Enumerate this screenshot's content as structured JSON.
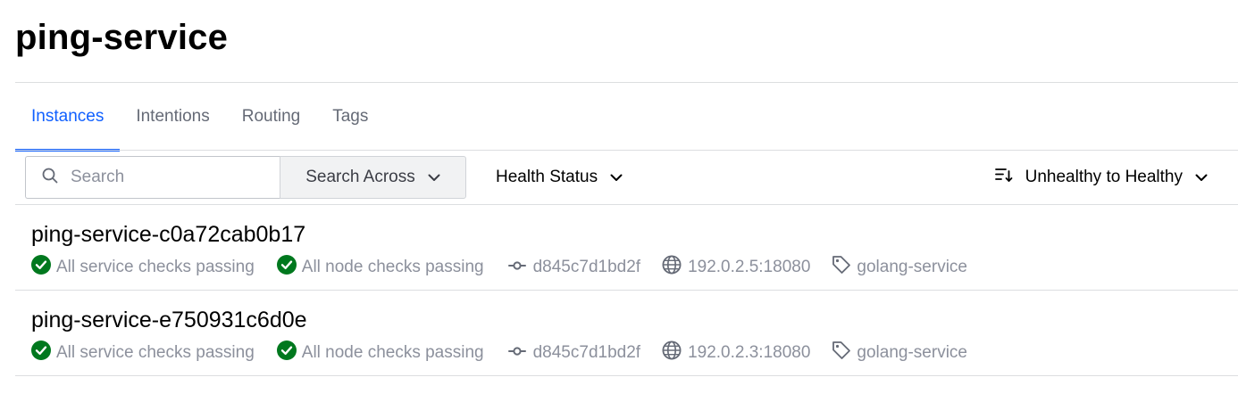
{
  "page": {
    "title": "ping-service"
  },
  "tabs": [
    {
      "label": "Instances",
      "active": true
    },
    {
      "label": "Intentions",
      "active": false
    },
    {
      "label": "Routing",
      "active": false
    },
    {
      "label": "Tags",
      "active": false
    }
  ],
  "toolbar": {
    "search_placeholder": "Search",
    "search_across_label": "Search Across",
    "health_status_label": "Health Status",
    "sort_label": "Unhealthy to Healthy"
  },
  "instances": [
    {
      "name": "ping-service-c0a72cab0b17",
      "service_checks": "All service checks passing",
      "node_checks": "All node checks passing",
      "node": "d845c7d1bd2f",
      "address": "192.0.2.5:18080",
      "tag": "golang-service"
    },
    {
      "name": "ping-service-e750931c6d0e",
      "service_checks": "All service checks passing",
      "node_checks": "All node checks passing",
      "node": "d845c7d1bd2f",
      "address": "192.0.2.3:18080",
      "tag": "golang-service"
    }
  ],
  "colors": {
    "accent": "#1060ff",
    "passing": "#00781e",
    "muted": "#8c909c",
    "border": "#dcdee0"
  },
  "icons": {
    "search": "search-icon",
    "dropdown": "chevron-down-icon",
    "sort": "sort-desc-icon",
    "passing": "check-circle-icon",
    "node": "git-commit-icon",
    "address": "globe-icon",
    "tag": "tag-icon"
  }
}
